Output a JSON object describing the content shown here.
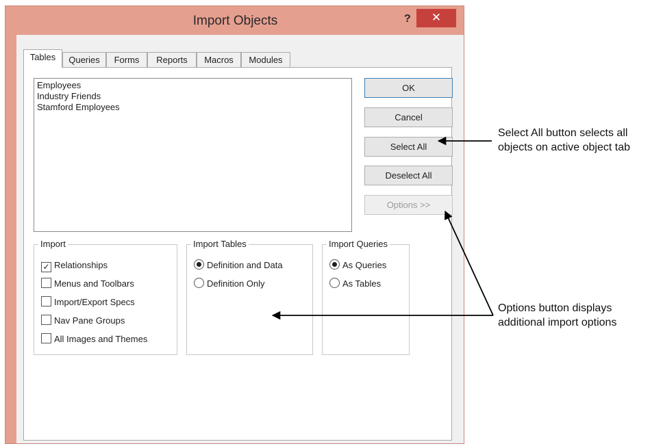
{
  "window": {
    "title": "Import Objects",
    "help_label": "?",
    "close_label": "✕"
  },
  "tabs": [
    "Tables",
    "Queries",
    "Forms",
    "Reports",
    "Macros",
    "Modules"
  ],
  "objects": [
    "Employees",
    "Industry Friends",
    "Stamford Employees"
  ],
  "buttons": {
    "ok": "OK",
    "cancel": "Cancel",
    "select_all": "Select All",
    "deselect_all": "Deselect All",
    "options": "Options >>"
  },
  "import_group": {
    "title": "Import",
    "items": [
      "Relationships",
      "Menus and Toolbars",
      "Import/Export Specs",
      "Nav Pane Groups",
      "All Images and Themes"
    ],
    "checked": [
      true,
      false,
      false,
      false,
      false
    ]
  },
  "import_tables": {
    "title": "Import Tables",
    "options": [
      "Definition and Data",
      "Definition Only"
    ],
    "selected": 0
  },
  "import_queries": {
    "title": "Import Queries",
    "options": [
      "As Queries",
      "As Tables"
    ],
    "selected": 0
  },
  "annotations": {
    "select_all": [
      "Select All button selects all",
      "objects on active object tab"
    ],
    "options": [
      "Options button displays",
      "additional import options"
    ]
  }
}
